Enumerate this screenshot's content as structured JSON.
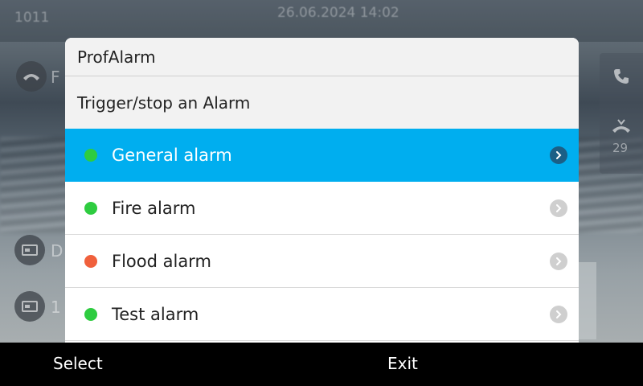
{
  "background": {
    "extension": "1011",
    "datetime": "26.06.2024 14:02",
    "line_label_partial": "F",
    "item2_partial": "D",
    "item3_partial": "1",
    "missed_count": "29"
  },
  "dialog": {
    "title": "ProfAlarm",
    "subtitle": "Trigger/stop an Alarm",
    "items": [
      {
        "label": "General alarm",
        "status_color": "#2ecc40",
        "selected": true
      },
      {
        "label": "Fire alarm",
        "status_color": "#2ecc40",
        "selected": false
      },
      {
        "label": "Flood alarm",
        "status_color": "#f0603c",
        "selected": false
      },
      {
        "label": "Test alarm",
        "status_color": "#2ecc40",
        "selected": false
      }
    ]
  },
  "softkeys": {
    "left_label": "Select",
    "right_label": "Exit"
  },
  "colors": {
    "selection": "#00aeef",
    "status_green": "#2ecc40",
    "status_orange": "#f0603c"
  }
}
